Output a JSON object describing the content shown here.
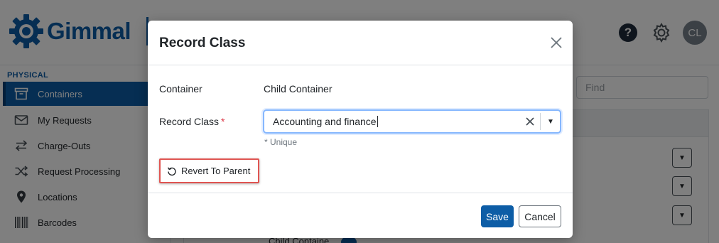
{
  "app": {
    "brand": "Gimmal",
    "help_glyph": "?",
    "avatar_initials": "CL",
    "find_placeholder": "Find",
    "sidebar": {
      "section": "PHYSICAL",
      "items": [
        {
          "label": "Containers",
          "icon": "archive-box-icon",
          "active": true
        },
        {
          "label": "My Requests",
          "icon": "envelope-icon",
          "active": false
        },
        {
          "label": "Charge-Outs",
          "icon": "swap-arrows-icon",
          "active": false
        },
        {
          "label": "Request Processing",
          "icon": "shuffle-icon",
          "active": false
        },
        {
          "label": "Locations",
          "icon": "map-pin-icon",
          "active": false
        },
        {
          "label": "Barcodes",
          "icon": "barcode-icon",
          "active": false
        }
      ]
    },
    "background_row_text": "Child Containe"
  },
  "modal": {
    "title": "Record Class",
    "container_label": "Container",
    "container_value": "Child Container",
    "record_class_label": "Record Class",
    "required_mark": "*",
    "record_class_value": "Accounting and finance",
    "hint": "* Unique",
    "revert_label": "Revert To Parent",
    "save_label": "Save",
    "cancel_label": "Cancel"
  },
  "colors": {
    "brand_blue": "#0d5da6",
    "highlight_red": "#e05552",
    "backdrop": "rgba(0,0,0,0.5)"
  }
}
